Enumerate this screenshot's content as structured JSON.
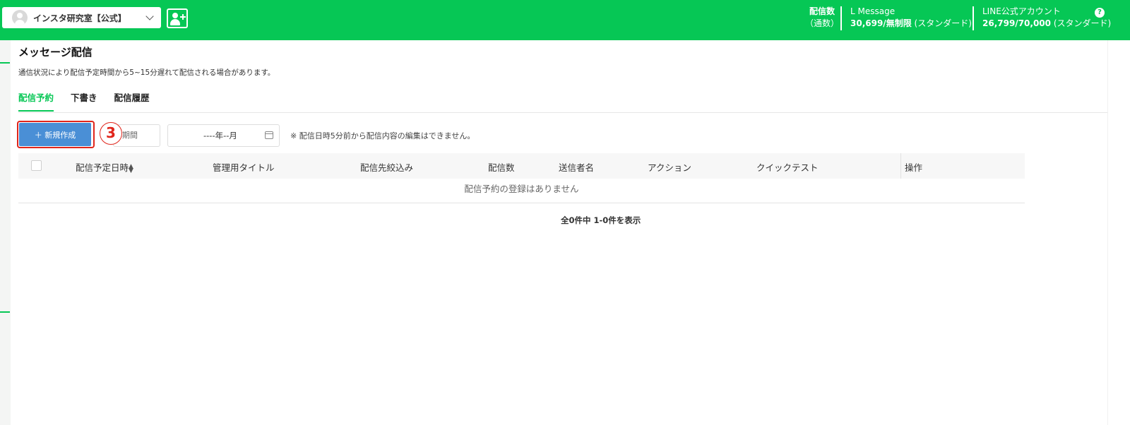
{
  "header": {
    "account_name": "インスタ研究室【公式】",
    "stats": {
      "delivery_count_label": "配信数",
      "delivery_count_unit": "（通数）",
      "lmessage_label": "L Message",
      "lmessage_value": "30,699/無制限",
      "lmessage_plan": "(スタンダード)",
      "line_label": "LINE公式アカウント",
      "line_value": "26,799/70,000",
      "line_plan": "(スタンダード)"
    }
  },
  "page": {
    "title": "メッセージ配信",
    "notice": "通信状況により配信予定時間から5~15分遅れて配信される場合があります。"
  },
  "tabs": [
    {
      "label": "配信予約",
      "active": true
    },
    {
      "label": "下書き",
      "active": false
    },
    {
      "label": "配信履歴",
      "active": false
    }
  ],
  "toolbar": {
    "new_button": "＋ 新規作成",
    "step_marker": "3",
    "period_select": "期間",
    "month_placeholder": "----年--月",
    "edit_note": "※ 配信日時5分前から配信内容の編集はできません。"
  },
  "table": {
    "columns": [
      "配信予定日時",
      "管理用タイトル",
      "配信先絞込み",
      "配信数",
      "送信者名",
      "アクション",
      "クイックテスト",
      "操作"
    ],
    "empty_message": "配信予約の登録はありません",
    "pagination": "全0件中 1-0件を表示"
  },
  "colors": {
    "brand": "#06c755",
    "primary_button": "#4a8fd6",
    "highlight": "#e0251b"
  }
}
